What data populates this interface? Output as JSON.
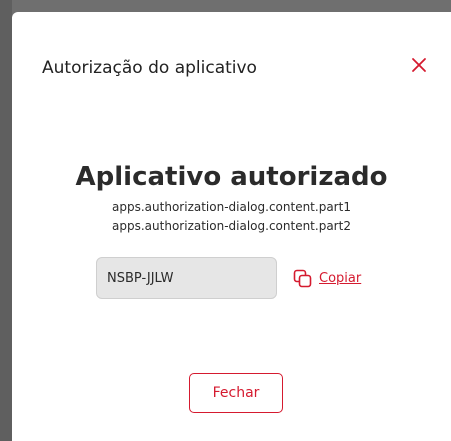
{
  "dialog": {
    "title": "Autorização do aplicativo",
    "close_icon": "close-icon",
    "heading": "Aplicativo autorizado",
    "line_1": "apps.authorization-dialog.content.part1",
    "line_2": "apps.authorization-dialog.content.part2",
    "code_value": "NSBP-JJLW",
    "copy_label": "Copiar",
    "copy_icon": "copy-icon",
    "close_button_label": "Fechar"
  },
  "colors": {
    "accent": "#d51a2f",
    "text": "#2b2b2b",
    "field_bg": "#e6e6e6",
    "overlay": "#6f6f6f"
  }
}
